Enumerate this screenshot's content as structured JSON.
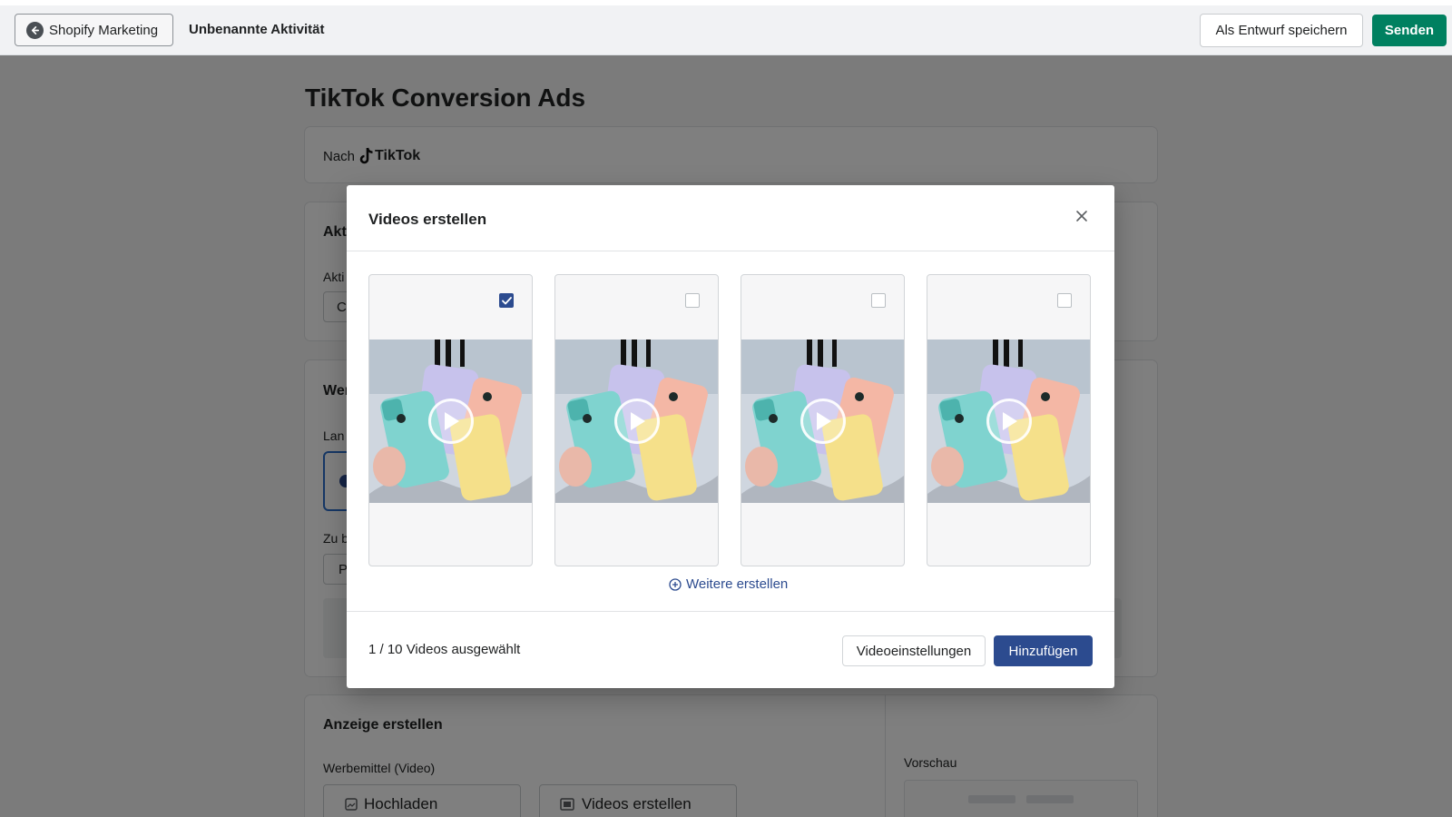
{
  "topbar": {
    "back_label": "Shopify Marketing",
    "activity_name": "Unbenannte Aktivität",
    "draft_label": "Als Entwurf speichern",
    "send_label": "Senden"
  },
  "page": {
    "title": "TikTok Conversion Ads",
    "destination_prefix": "Nach",
    "destination_brand": "TikTok",
    "card2_heading_partial": "Akt",
    "card2_field_label_partial": "Akti",
    "card2_field_value_partial": "C",
    "card3_heading_partial": "Wer",
    "card3_field_label_partial": "Lan",
    "card3_label2_partial": "Zu b",
    "card3_field2_partial": "P",
    "ad_heading": "Anzeige erstellen",
    "ad_asset_label": "Werbemittel (Video)",
    "upload_label": "Hochladen",
    "create_videos_label": "Videos erstellen",
    "preview_label": "Vorschau"
  },
  "modal": {
    "title": "Videos erstellen",
    "videos": [
      {
        "checked": true
      },
      {
        "checked": false
      },
      {
        "checked": false
      },
      {
        "checked": false
      }
    ],
    "more_label": "Weitere erstellen",
    "selected_text": "1 / 10 Videos ausgewählt",
    "settings_label": "Videoeinstellungen",
    "add_label": "Hinzufügen"
  },
  "colors": {
    "primary_green": "#008060",
    "modal_primary": "#2c4b8f",
    "checked": "#2c4b8f"
  }
}
